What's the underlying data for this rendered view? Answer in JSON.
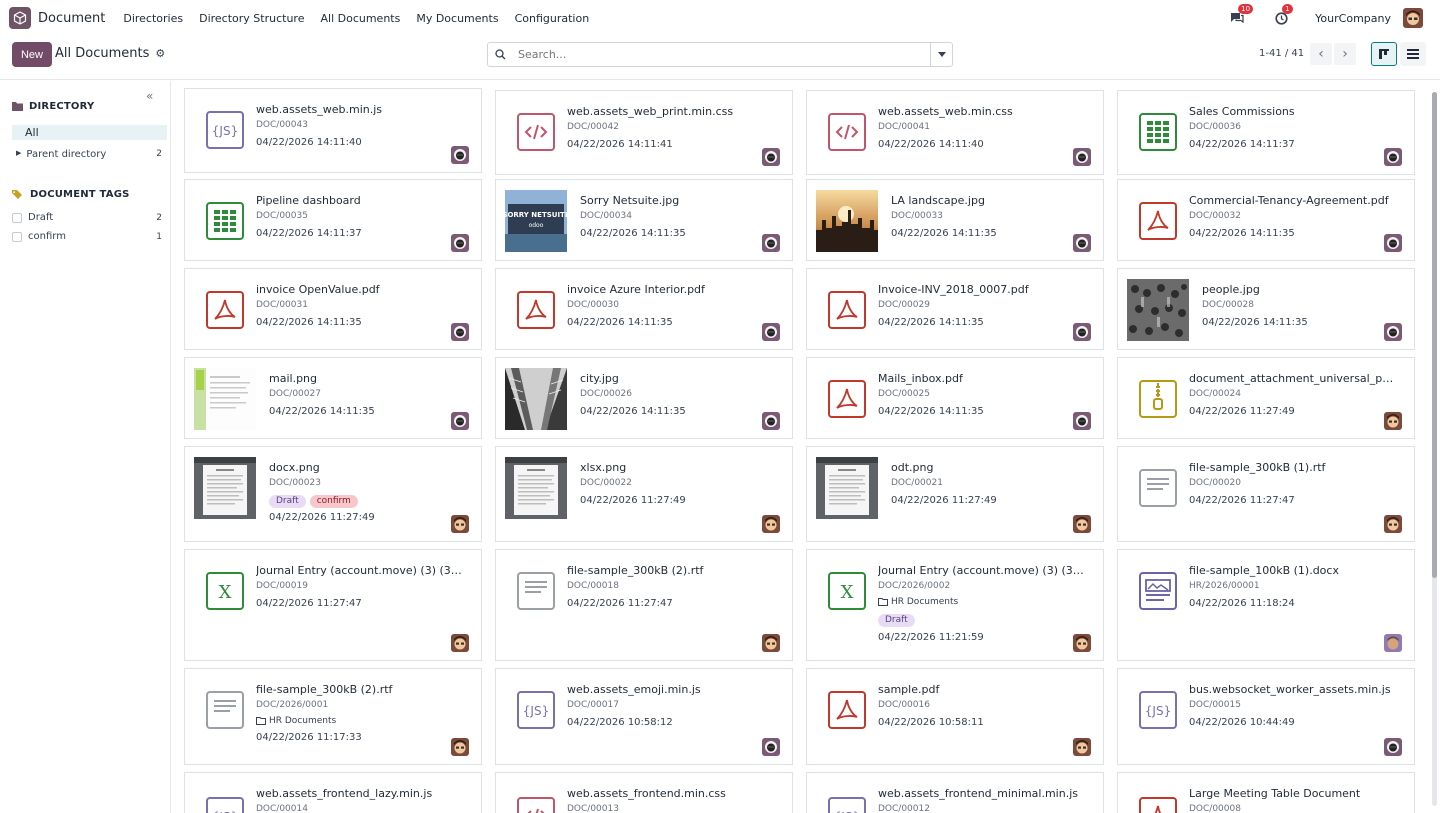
{
  "app": {
    "name": "Document"
  },
  "nav": [
    "Directories",
    "Directory Structure",
    "All Documents",
    "My Documents",
    "Configuration"
  ],
  "topright": {
    "messages_count": "10",
    "activities_count": "1",
    "company": "YourCompany"
  },
  "control": {
    "new_label": "New",
    "breadcrumb": "All Documents",
    "search_placeholder": "Search...",
    "pager": "1-41 / 41"
  },
  "sidebar": {
    "directory_title": "DIRECTORY",
    "all_label": "All",
    "parent_label": "Parent directory",
    "parent_count": "2",
    "tags_title": "DOCUMENT TAGS",
    "tags": [
      {
        "label": "Draft",
        "count": "2"
      },
      {
        "label": "confirm",
        "count": "1"
      }
    ]
  },
  "colors": {
    "brand": "#714b67",
    "selected_bg": "#e6f2f3",
    "pdf": "#c0392b",
    "sheet": "#2e8b3a",
    "js": "#7a6fb0",
    "css": "#c0556b",
    "zip": "#b59a16"
  },
  "cards": [
    {
      "name": "web.assets_web.min.js",
      "ref": "DOC/00043",
      "date": "04/22/2026 14:11:40",
      "icon": "js-icon",
      "avatar": "bot"
    },
    {
      "name": "web.assets_web_print.min.css",
      "ref": "DOC/00042",
      "date": "04/22/2026 14:11:41",
      "icon": "css-icon",
      "avatar": "bot"
    },
    {
      "name": "web.assets_web.min.css",
      "ref": "DOC/00041",
      "date": "04/22/2026 14:11:40",
      "icon": "css-icon",
      "avatar": "bot"
    },
    {
      "name": "Sales Commissions",
      "ref": "DOC/00036",
      "date": "04/22/2026 14:11:37",
      "icon": "spreadsheet-icon",
      "avatar": "bot"
    },
    {
      "name": "Pipeline dashboard",
      "ref": "DOC/00035",
      "date": "04/22/2026 14:11:37",
      "icon": "spreadsheet-icon",
      "avatar": "bot"
    },
    {
      "name": "Sorry Netsuite.jpg",
      "ref": "DOC/00034",
      "date": "04/22/2026 14:11:35",
      "icon": "billboard-image",
      "avatar": "bot",
      "thumb_text": "SORRY NETSUITE"
    },
    {
      "name": "LA landscape.jpg",
      "ref": "DOC/00033",
      "date": "04/22/2026 14:11:35",
      "icon": "landscape-image",
      "avatar": "bot"
    },
    {
      "name": "Commercial-Tenancy-Agreement.pdf",
      "ref": "DOC/00032",
      "date": "04/22/2026 14:11:35",
      "icon": "pdf-icon",
      "avatar": "bot"
    },
    {
      "name": "invoice OpenValue.pdf",
      "ref": "DOC/00031",
      "date": "04/22/2026 14:11:35",
      "icon": "pdf-icon",
      "avatar": "bot"
    },
    {
      "name": "invoice Azure Interior.pdf",
      "ref": "DOC/00030",
      "date": "04/22/2026 14:11:35",
      "icon": "pdf-icon",
      "avatar": "bot"
    },
    {
      "name": "Invoice-INV_2018_0007.pdf",
      "ref": "DOC/00029",
      "date": "04/22/2026 14:11:35",
      "icon": "pdf-icon",
      "avatar": "bot"
    },
    {
      "name": "people.jpg",
      "ref": "DOC/00028",
      "date": "04/22/2026 14:11:35",
      "icon": "people-image",
      "avatar": "bot"
    },
    {
      "name": "mail.png",
      "ref": "DOC/00027",
      "date": "04/22/2026 14:11:35",
      "icon": "mail-image",
      "avatar": "bot"
    },
    {
      "name": "city.jpg",
      "ref": "DOC/00026",
      "date": "04/22/2026 14:11:35",
      "icon": "city-image",
      "avatar": "bot"
    },
    {
      "name": "Mails_inbox.pdf",
      "ref": "DOC/00025",
      "date": "04/22/2026 14:11:35",
      "icon": "pdf-icon",
      "avatar": "bot"
    },
    {
      "name": "document_attachment_universal_pr...",
      "ref": "DOC/00024",
      "date": "04/22/2026 11:27:49",
      "icon": "zip-icon",
      "avatar": "user"
    },
    {
      "name": "docx.png",
      "ref": "DOC/00023",
      "date": "04/22/2026 11:27:49",
      "icon": "doc-image",
      "avatar": "user",
      "tags": [
        "Draft",
        "confirm"
      ]
    },
    {
      "name": "xlsx.png",
      "ref": "DOC/00022",
      "date": "04/22/2026 11:27:49",
      "icon": "doc-image",
      "avatar": "user"
    },
    {
      "name": "odt.png",
      "ref": "DOC/00021",
      "date": "04/22/2026 11:27:49",
      "icon": "doc-image",
      "avatar": "user"
    },
    {
      "name": "file-sample_300kB (1).rtf",
      "ref": "DOC/00020",
      "date": "04/22/2026 11:27:47",
      "icon": "text-icon",
      "avatar": "user"
    },
    {
      "name": "Journal Entry (account.move) (3) (3)....",
      "ref": "DOC/00019",
      "date": "04/22/2026 11:27:47",
      "icon": "excel-icon",
      "avatar": "user"
    },
    {
      "name": "file-sample_300kB (2).rtf",
      "ref": "DOC/00018",
      "date": "04/22/2026 11:27:47",
      "icon": "text-icon",
      "avatar": "user"
    },
    {
      "name": "Journal Entry (account.move) (3) (3)....",
      "ref": "DOC/2026/0002",
      "date": "04/22/2026 11:21:59",
      "icon": "excel-icon",
      "avatar": "user",
      "folder": "HR Documents",
      "tags": [
        "Draft"
      ]
    },
    {
      "name": "file-sample_100kB (1).docx",
      "ref": "HR/2026/00001",
      "date": "04/22/2026 11:18:24",
      "icon": "word-icon",
      "avatar": "user2"
    },
    {
      "name": "file-sample_300kB (2).rtf",
      "ref": "DOC/2026/0001",
      "date": "04/22/2026 11:17:33",
      "icon": "text-icon",
      "avatar": "user",
      "folder": "HR Documents"
    },
    {
      "name": "web.assets_emoji.min.js",
      "ref": "DOC/00017",
      "date": "04/22/2026 10:58:12",
      "icon": "js-icon",
      "avatar": "bot"
    },
    {
      "name": "sample.pdf",
      "ref": "DOC/00016",
      "date": "04/22/2026 10:58:11",
      "icon": "pdf-icon",
      "avatar": "user"
    },
    {
      "name": "bus.websocket_worker_assets.min.js",
      "ref": "DOC/00015",
      "date": "04/22/2026 10:44:49",
      "icon": "js-icon",
      "avatar": "bot"
    },
    {
      "name": "web.assets_frontend_lazy.min.js",
      "ref": "DOC/00014",
      "date": "",
      "icon": "js-icon",
      "avatar": ""
    },
    {
      "name": "web.assets_frontend.min.css",
      "ref": "DOC/00013",
      "date": "",
      "icon": "css-icon",
      "avatar": ""
    },
    {
      "name": "web.assets_frontend_minimal.min.js",
      "ref": "DOC/00012",
      "date": "",
      "icon": "js-icon",
      "avatar": ""
    },
    {
      "name": "Large Meeting Table Document",
      "ref": "DOC/00008",
      "date": "",
      "icon": "pdf-icon",
      "avatar": ""
    }
  ]
}
